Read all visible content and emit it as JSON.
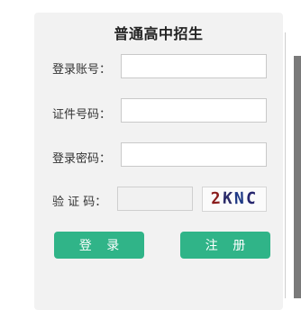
{
  "form": {
    "title": "普通高中招生",
    "account_label": "登录账号：",
    "account_value": "",
    "id_label": "证件号码：",
    "id_value": "",
    "password_label": "登录密码：",
    "password_value": "",
    "captcha_label": "验 证 码：",
    "captcha_value": "",
    "captcha_chars": [
      "2",
      "K",
      "N",
      "C"
    ],
    "captcha_colors": [
      "#8a1c1c",
      "#2c2c6a",
      "#1f3a86",
      "#26266e"
    ]
  },
  "buttons": {
    "login": "登 录",
    "register": "注 册"
  },
  "colors": {
    "button_bg": "#30b488",
    "panel_bg": "#f2f2f2"
  }
}
